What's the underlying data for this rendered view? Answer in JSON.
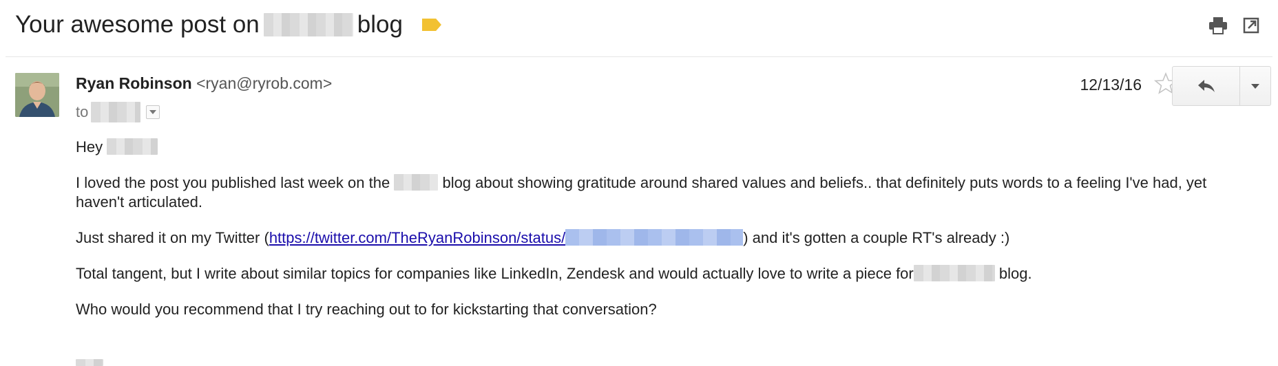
{
  "subject": {
    "prefix": "Your awesome post on",
    "suffix": "blog",
    "label_color": "#f2c132"
  },
  "toolbar": {
    "print_icon": "print-icon",
    "popout_icon": "open-in-new-window-icon"
  },
  "message": {
    "sender_name": "Ryan Robinson",
    "sender_email": "<ryan@ryrob.com>",
    "to_label": "to",
    "date": "12/13/16",
    "reply_icon": "reply-icon",
    "more_icon": "chevron-down-icon",
    "star_icon": "star-outline-icon"
  },
  "body": {
    "greeting": "Hey",
    "p1_before": "I loved the post you published last week on the",
    "p1_after": "blog about showing gratitude around shared values and beliefs.. that definitely puts words to a feeling I've had, yet haven't articulated.",
    "p2_before": "Just shared it on my Twitter (",
    "p2_link": "https://twitter.com/TheRyanRobinson/status/",
    "p2_after": ") and it's gotten a couple RT's already :)",
    "p3_before": "Total tangent, but I write about similar topics for companies like LinkedIn, Zendesk and would actually love to write a piece for",
    "p3_after": "blog.",
    "p4": "Who would you recommend that I try reaching out to for kickstarting that conversation?"
  },
  "colors": {
    "link": "#1a0dab",
    "text": "#222222",
    "muted": "#777777"
  }
}
